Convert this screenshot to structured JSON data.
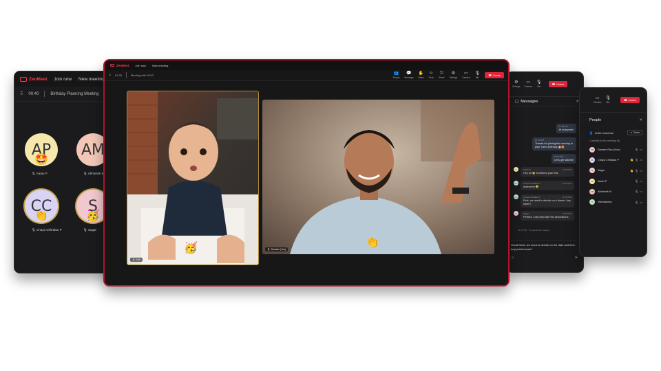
{
  "app": {
    "name": "ZenMeet"
  },
  "left_window": {
    "nav": [
      "Join now",
      "New meeting"
    ],
    "timer": "00:40",
    "meeting_title": "Birthday Planning Meeting",
    "participants": [
      {
        "initials": "AP",
        "name": "Aarav P",
        "color": "#f6e7ad",
        "emoji": "🤩"
      },
      {
        "initials": "AM",
        "name": "Abhishek M",
        "color": "#f3c7b8",
        "emoji": ""
      },
      {
        "initials": "CC",
        "name": "Chaya Chitrakar P",
        "color": "#d9d3f5",
        "emoji": "👏"
      },
      {
        "initials": "S",
        "name": "Sagar",
        "color": "#f2c8cf",
        "emoji": "🥳"
      }
    ]
  },
  "main_window": {
    "nav": [
      "Join now",
      "New meeting"
    ],
    "timer": "61:35",
    "meeting_title": "Meeting with NXIS",
    "tools": [
      {
        "label": "People",
        "icon": "👥"
      },
      {
        "label": "Message",
        "icon": "💬"
      },
      {
        "label": "Raise",
        "icon": "✋"
      },
      {
        "label": "Reac",
        "icon": "☺"
      },
      {
        "label": "Share",
        "icon": "⎋"
      },
      {
        "label": "Settings",
        "icon": "⚙"
      },
      {
        "label": "Camera",
        "icon": "▭"
      },
      {
        "label": "Mic",
        "icon": "🎙"
      }
    ],
    "leave_label": "Leave",
    "videos": {
      "baby_label": "Aditi",
      "man_label": "Sameer (You)"
    },
    "reactions": {
      "baby": "🥳",
      "man": "👏"
    }
  },
  "chat_window": {
    "tools": [
      {
        "label": "Settings",
        "icon": "⚙"
      },
      {
        "label": "Camera",
        "icon": "▭"
      },
      {
        "label": "Mic",
        "icon": "🎙"
      }
    ],
    "leave_label": "Leave",
    "title": "Messages",
    "messages_right": [
      {
        "time": "07:36 PM",
        "text": "Hi everyone!"
      },
      {
        "time": "07:37 PM",
        "text": "Thanks for joining the meeting to plan Tulu's birthday 🎂😍"
      },
      {
        "time": "07:37 PM",
        "text": "Let's get started!"
      }
    ],
    "messages_left": [
      {
        "initials": "A",
        "name": "Aarav P",
        "time": "07:37 PM",
        "text": "Hey all 👋 Excited to plan this.",
        "color": "#f6e7ad"
      },
      {
        "initials": "CC",
        "name": "Chaya Chitrakar P",
        "time": "07:37 PM",
        "text": "Awesome 😀",
        "color": "#bfe3dc"
      },
      {
        "initials": "CC",
        "name": "Chaya Chitrakar P",
        "time": "07:37 PM",
        "text": "First, we need to decide on a theme. Any ideas?",
        "color": "#bfe3dc"
      },
      {
        "initials": "S",
        "name": "Sagar",
        "time": "07:37 PM",
        "text": "Perfect. I can help with the decorations.",
        "color": "#f2c8cf"
      }
    ],
    "system": "07:37 PM · You joined the meeting",
    "draft": "Great! Next, we need to decide on the date and time. Any preferences?"
  },
  "people_window": {
    "tools": [
      {
        "label": "Camera",
        "icon": "▭"
      },
      {
        "label": "Mic",
        "icon": "🎙"
      }
    ],
    "leave_label": "Leave",
    "title": "People",
    "invite_label": "Invite someone",
    "share_label": "Share",
    "caption": "Currently in this meeting (6)",
    "people": [
      {
        "initials": "SR",
        "name": "Sameer Rizvi (You)",
        "color": "#f2c8cf",
        "hand": ""
      },
      {
        "initials": "CC",
        "name": "Chaya Chitrakar P",
        "color": "#d9d3f5",
        "hand": "👋"
      },
      {
        "initials": "S",
        "name": "Sagar",
        "color": "#f2c8cf",
        "hand": "👋"
      },
      {
        "initials": "AP",
        "name": "Aarav P",
        "color": "#f6e7ad",
        "hand": ""
      },
      {
        "initials": "AM",
        "name": "Abhishek M",
        "color": "#f3c7b8",
        "hand": ""
      },
      {
        "initials": "V",
        "name": "Vishwadeep",
        "color": "#bfe3c2",
        "hand": ""
      }
    ]
  }
}
